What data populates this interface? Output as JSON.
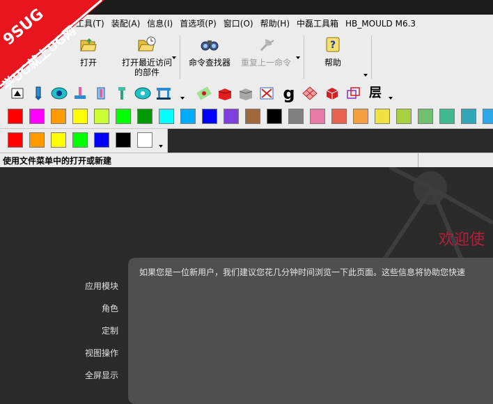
{
  "menubar": {
    "items": [
      {
        "label": "工具(T)"
      },
      {
        "label": "装配(A)"
      },
      {
        "label": "信息(I)"
      },
      {
        "label": "首选项(P)"
      },
      {
        "label": "窗口(O)"
      },
      {
        "label": "帮助(H)"
      },
      {
        "label": "中磊工具箱"
      },
      {
        "label": "HB_MOULD M6.3"
      }
    ]
  },
  "ribbon": {
    "open": "打开",
    "recent_line1": "打开最近访问",
    "recent_line2": "的部件",
    "command_finder": "命令查找器",
    "repeat_last": "重复上一命令",
    "help": "帮助"
  },
  "toolbar": {
    "g_glyph": "g",
    "layer_glyph": "层"
  },
  "colors": {
    "row1": [
      "#ff0000",
      "#ff00ff",
      "#ff9900",
      "#ffff00",
      "#ccff33",
      "#00ff00",
      "#009900",
      "#00ffff",
      "#00aaff",
      "#0000ff",
      "#7f3fdf",
      "#a0683c",
      "#000000",
      "#808080",
      "#e87aa8",
      "#e86050",
      "#f4a040",
      "#f0e040",
      "#a8d040",
      "#70c070",
      "#40b890",
      "#30a8b8",
      "#30a8e8"
    ],
    "row2": [
      "#ff0000",
      "#ff9900",
      "#ffff00",
      "#00ff00",
      "#0000ff",
      "#000000",
      "#ffffff"
    ]
  },
  "status": {
    "text": "使用文件菜单中的打开或新建"
  },
  "welcome": {
    "title": "欢迎使",
    "intro": "如果您是一位新用户，我们建议您花几分钟时间浏览一下此页面。这些信息将协助您快速",
    "links": [
      "应用模块",
      "角色",
      "定制",
      "视图操作",
      "全屏显示"
    ]
  },
  "logo": {
    "line1": "9SUG",
    "line2": "学UG就上UG网"
  }
}
